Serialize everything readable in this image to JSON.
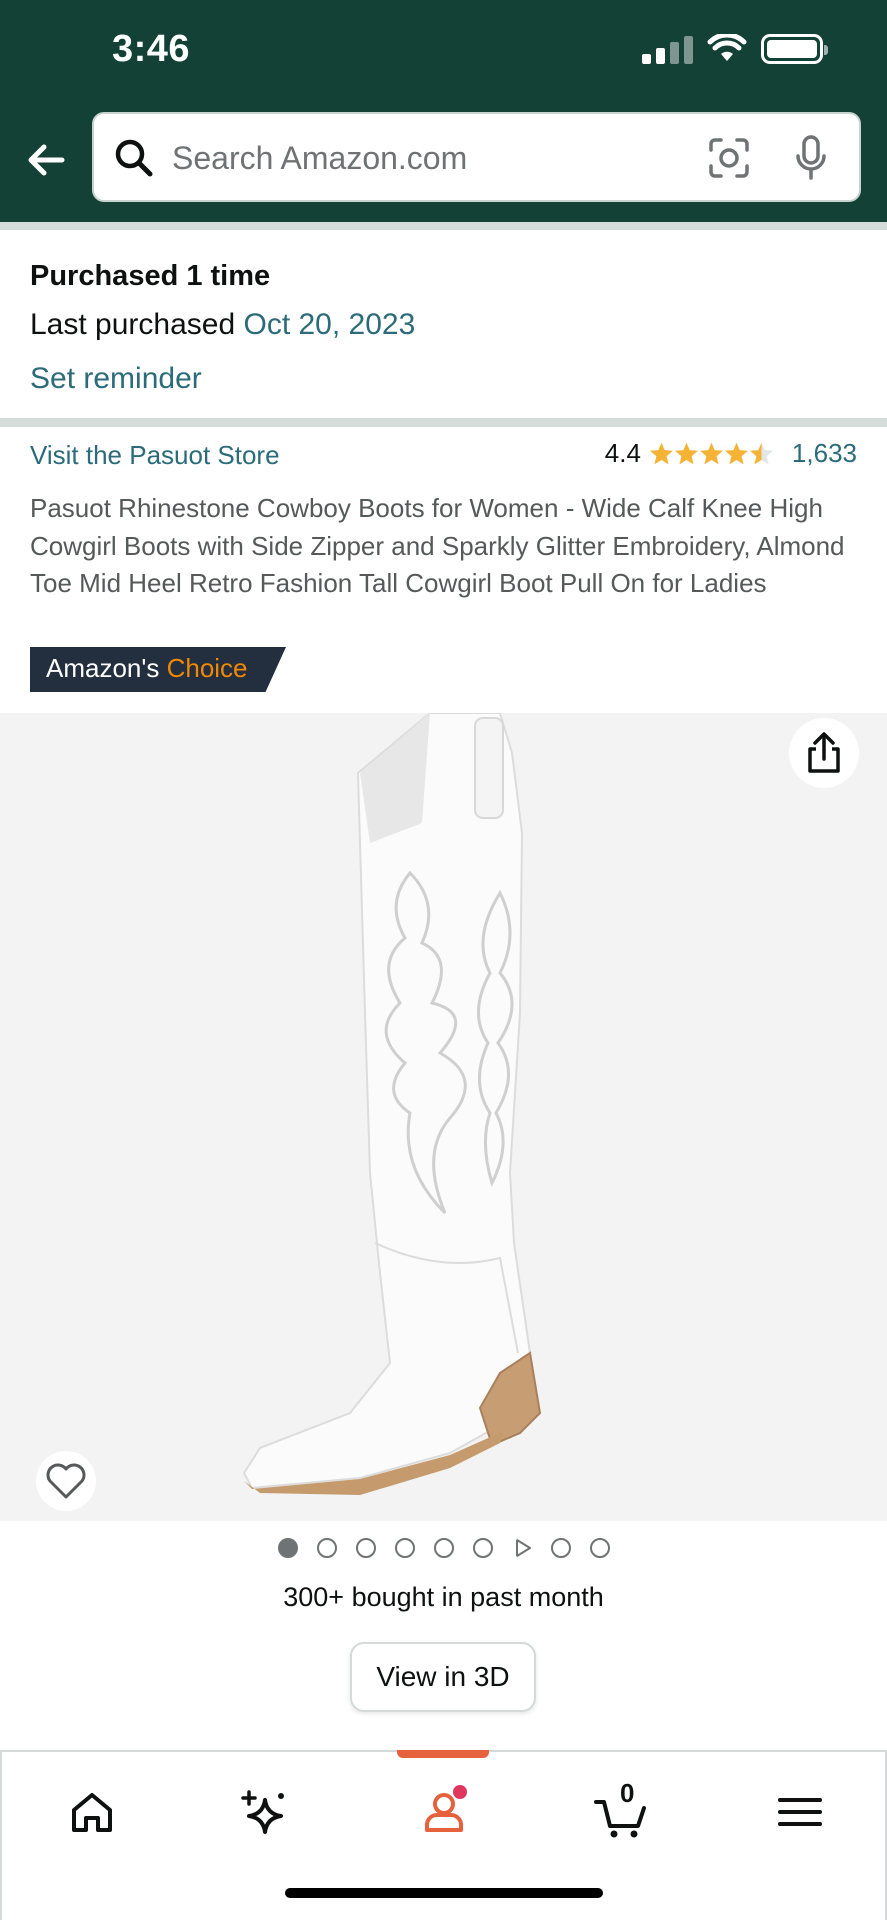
{
  "status_bar": {
    "time": "3:46"
  },
  "header": {
    "search_placeholder": "Search Amazon.com",
    "colors": {
      "background": "#134135",
      "accent_link": "#2b6b7a"
    }
  },
  "purchase_history": {
    "purchased_times": "Purchased 1 time",
    "last_purchased_label": "Last purchased",
    "last_purchased_date": "Oct 20, 2023",
    "set_reminder": "Set reminder"
  },
  "product": {
    "store_link": "Visit the Pasuot Store",
    "rating_value": "4.4",
    "rating_stars": 4.4,
    "review_count": "1,633",
    "title": "Pasuot Rhinestone Cowboy Boots for Women - Wide Calf Knee High Cowgirl Boots with Side Zipper and Sparkly Glitter Embroidery, Almond Toe Mid Heel Retro Fashion Tall Cowgirl Boot Pull On for Ladies",
    "badge_prefix": "Amazon's",
    "badge_suffix": "Choice",
    "image_alt": "white cowboy boot",
    "image_count": 9,
    "active_image": 1,
    "bought_text": "300+ bought in past month",
    "view_3d": "View in 3D"
  },
  "bottom_nav": {
    "items": [
      "home-icon",
      "sparkle-icon",
      "account-icon",
      "cart-icon",
      "menu-icon"
    ],
    "active": "account-icon",
    "cart_count": "0"
  }
}
